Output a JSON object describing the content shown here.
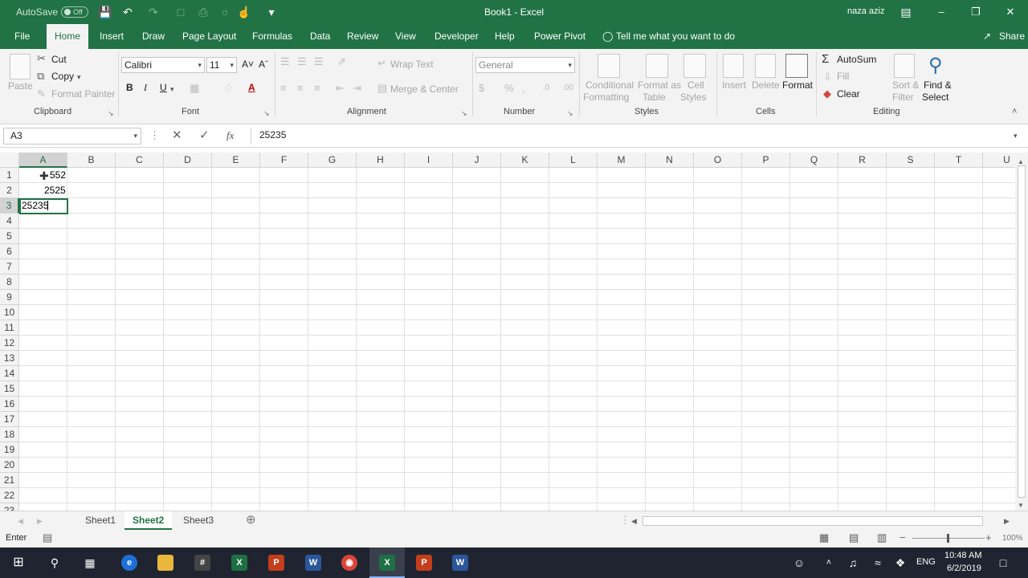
{
  "title_bar": {
    "autosave_label": "AutoSave",
    "autosave_state": "Off",
    "window_title": "Book1  -  Excel",
    "user_name": "naza aziz"
  },
  "ribbon_tabs": [
    "File",
    "Home",
    "Insert",
    "Draw",
    "Page Layout",
    "Formulas",
    "Data",
    "Review",
    "View",
    "Developer",
    "Help",
    "Power Pivot"
  ],
  "active_tab": "Home",
  "tell_me": "Tell me what you want to do",
  "share": "Share",
  "clipboard": {
    "paste": "Paste",
    "cut": "Cut",
    "copy": "Copy",
    "format_painter": "Format Painter",
    "group": "Clipboard"
  },
  "font": {
    "name": "Calibri",
    "size": "11",
    "group": "Font",
    "bold": "B",
    "italic": "I",
    "underline": "U"
  },
  "alignment": {
    "wrap_text": "Wrap Text",
    "merge_center": "Merge & Center",
    "group": "Alignment"
  },
  "number": {
    "format": "General",
    "group": "Number"
  },
  "styles": {
    "conditional_1": "Conditional",
    "conditional_2": "Formatting",
    "format_table_1": "Format as",
    "format_table_2": "Table",
    "cell_styles_1": "Cell",
    "cell_styles_2": "Styles",
    "group": "Styles"
  },
  "cells": {
    "insert": "Insert",
    "delete": "Delete",
    "format": "Format",
    "group": "Cells"
  },
  "editing": {
    "autosum": "AutoSum",
    "fill": "Fill",
    "clear": "Clear",
    "sort_1": "Sort &",
    "sort_2": "Filter",
    "find_1": "Find &",
    "find_2": "Select",
    "group": "Editing"
  },
  "formula_bar": {
    "name_box": "A3",
    "fx": "fx",
    "value": "25235"
  },
  "columns": [
    "A",
    "B",
    "C",
    "D",
    "E",
    "F",
    "G",
    "H",
    "I",
    "J",
    "K",
    "L",
    "M",
    "N",
    "O",
    "P",
    "Q",
    "R",
    "S",
    "T",
    "U"
  ],
  "rows": [
    "1",
    "2",
    "3",
    "4",
    "5",
    "6",
    "7",
    "8",
    "9",
    "10",
    "11",
    "12",
    "13",
    "14",
    "15",
    "16",
    "17",
    "18",
    "19",
    "20",
    "21",
    "22",
    "23"
  ],
  "cells_data": {
    "A1": "552",
    "A2": "2525",
    "A3": "25235"
  },
  "sheets": [
    "Sheet1",
    "Sheet2",
    "Sheet3"
  ],
  "active_sheet": "Sheet2",
  "status": {
    "mode": "Enter",
    "zoom": "100%"
  },
  "taskbar": {
    "time": "10:48 AM",
    "date": "6/2/2019",
    "lang": "ENG"
  },
  "colors": {
    "excel_green": "#217346",
    "taskbar": "#1f2430"
  }
}
